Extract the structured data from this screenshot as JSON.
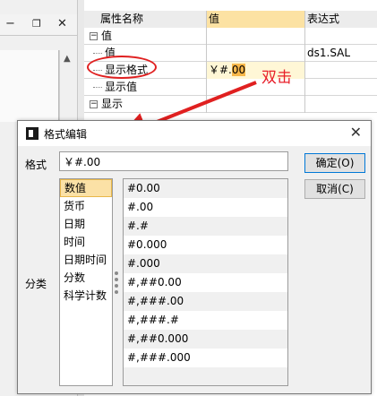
{
  "property_grid": {
    "headers": {
      "name": "属性名称",
      "value": "值",
      "expression": "表达式"
    },
    "rows": [
      {
        "name": "值",
        "value": "",
        "expression": "",
        "toggle": "−",
        "group": true
      },
      {
        "name": "值",
        "value": "",
        "expression": "ds1.SAL",
        "group": false
      },
      {
        "name": "显示格式",
        "value_prefix": "￥#.",
        "value_highlight": "00",
        "expression": "",
        "group": false
      },
      {
        "name": "显示值",
        "value": "",
        "expression": "",
        "group": false
      },
      {
        "name": "显示",
        "value": "",
        "expression": "",
        "toggle": "−",
        "group": true
      }
    ]
  },
  "annotation": {
    "text": "双击",
    "color": "#e8202a"
  },
  "dialog": {
    "title": "格式编辑",
    "format_label": "格式",
    "format_value": "￥#.00",
    "ok_button": "确定(O)",
    "cancel_button": "取消(C)",
    "category_label": "分类",
    "categories": [
      "数值",
      "货币",
      "日期",
      "时间",
      "日期时间",
      "分数",
      "科学计数"
    ],
    "selected_category": "数值",
    "formats": [
      "#0.00",
      "#.00",
      "#.#",
      "#0.000",
      "#.000",
      "#,##0.00",
      "#,###.00",
      "#,###.#",
      "#,##0.000",
      "#,###.000",
      "",
      ""
    ]
  },
  "colors": {
    "selection": "#fbe1a6",
    "header_value": "#fce2a3",
    "ellipse": "#e02020"
  }
}
